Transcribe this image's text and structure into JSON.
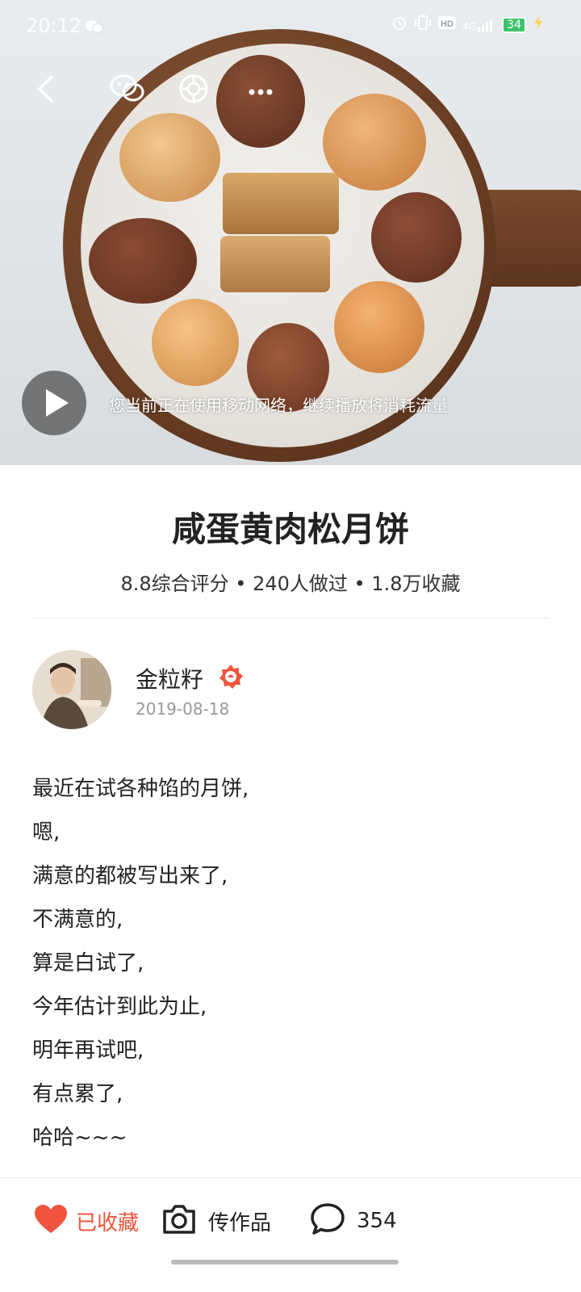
{
  "status_bar": {
    "time": "20:12",
    "network_label": "4G",
    "battery_level": "34",
    "icons": [
      "wechat-icon",
      "alarm-icon",
      "vibrate-icon",
      "hd-icon",
      "signal-icon",
      "battery-icon",
      "charging-icon"
    ]
  },
  "hero": {
    "nav_icons": [
      "back-icon",
      "wechat-share-icon",
      "moments-share-icon",
      "more-icon"
    ],
    "play_icon": "play-icon",
    "network_notice": "您当前正在使用移动网络，继续播放将消耗流量"
  },
  "recipe": {
    "title": "咸蛋黄肉松月饼",
    "stats": "8.8综合评分 • 240人做过 • 1.8万收藏"
  },
  "author": {
    "name": "金粒籽",
    "date": "2019-08-18",
    "badge_icon": "chef-badge-icon",
    "badge_color": "#f0543c"
  },
  "description": [
    "最近在试各种馅的月饼,",
    "嗯,",
    "满意的都被写出来了,",
    "不满意的,",
    "算是白试了,",
    "今年估计到此为止,",
    "明年再试吧,",
    "有点累了,",
    "哈哈~~~"
  ],
  "bottom_bar": {
    "favorite_label": "已收藏",
    "upload_label": "传作品",
    "comment_count": "354",
    "accent_color": "#f0543c"
  }
}
